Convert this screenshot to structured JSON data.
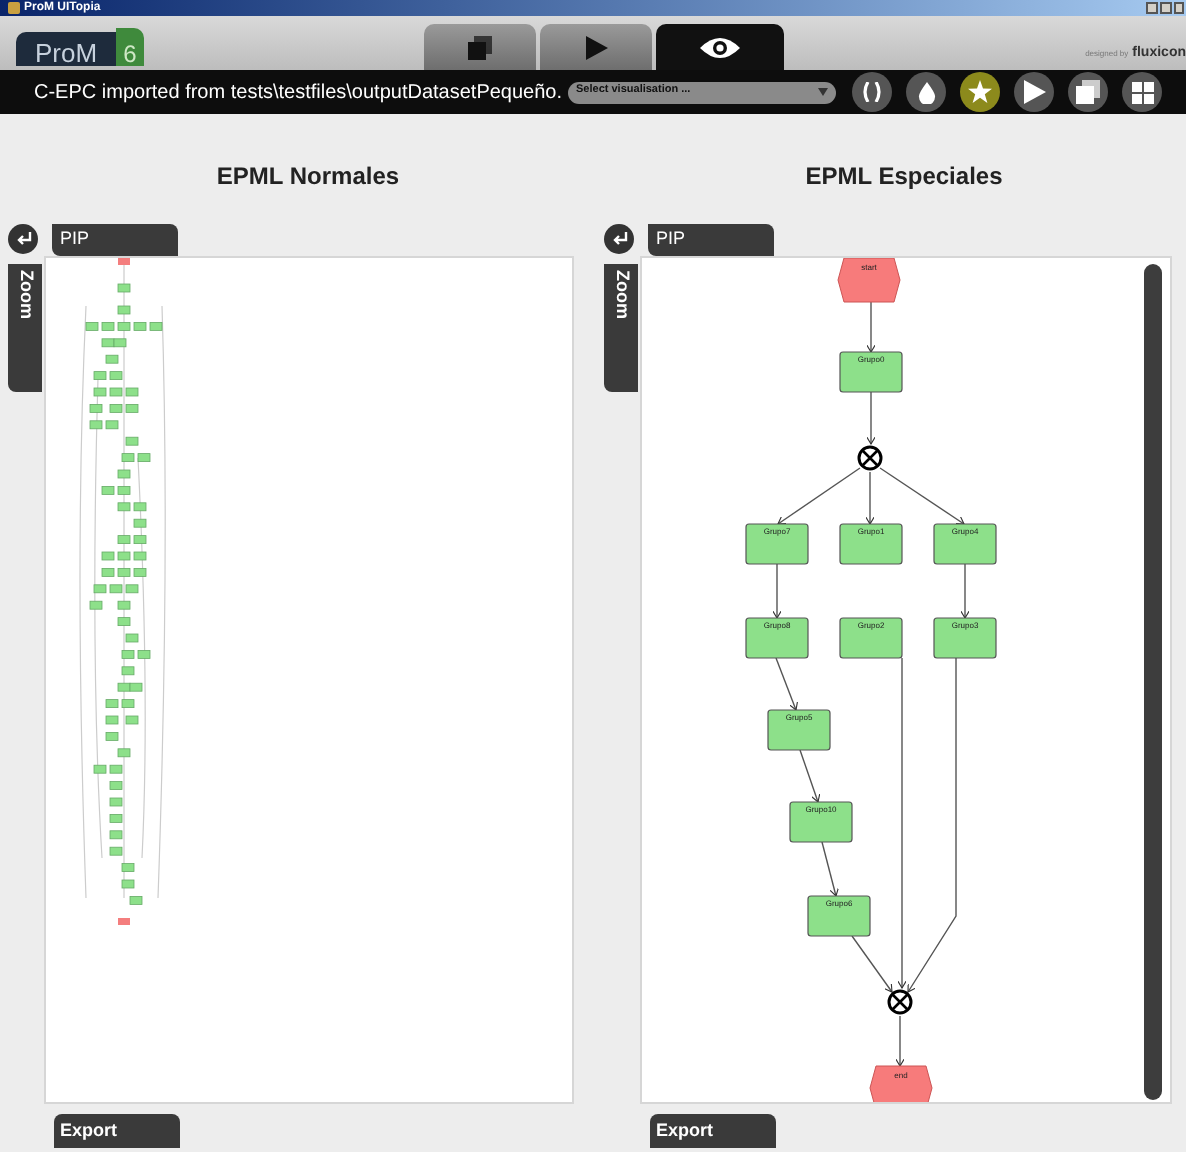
{
  "window": {
    "title": "ProM UITopia"
  },
  "logo": {
    "name": "ProM",
    "version": "6"
  },
  "credit": {
    "prefix": "designed by",
    "brand": "fluxicon"
  },
  "tabs": [
    {
      "selected": false
    },
    {
      "selected": false
    },
    {
      "selected": true
    }
  ],
  "toolbar": {
    "title": "C-EPC imported from tests\\testfiles\\outputDatasetPequeño.",
    "select": {
      "placeholder": "Select visualisation ..."
    },
    "actions": [
      {
        "selected": false
      },
      {
        "selected": false
      },
      {
        "selected": true
      },
      {
        "selected": false
      },
      {
        "selected": false
      },
      {
        "selected": false
      }
    ]
  },
  "panels": [
    {
      "heading": "EPML Normales",
      "pip": "PIP",
      "zoom": "Zoom",
      "export": "Export",
      "graph": {
        "kind": "miniature"
      }
    },
    {
      "heading": "EPML Especiales",
      "pip": "PIP",
      "zoom": "Zoom",
      "export": "Export",
      "graph": {
        "kind": "detailed",
        "nodes": [
          {
            "kind": "event",
            "label": "start"
          },
          {
            "kind": "function",
            "label": "Grupo0"
          },
          {
            "kind": "connector"
          },
          {
            "kind": "function",
            "label": "Grupo7"
          },
          {
            "kind": "function",
            "label": "Grupo1"
          },
          {
            "kind": "function",
            "label": "Grupo4"
          },
          {
            "kind": "function",
            "label": "Grupo8"
          },
          {
            "kind": "function",
            "label": "Grupo2"
          },
          {
            "kind": "function",
            "label": "Grupo3"
          },
          {
            "kind": "function",
            "label": "Grupo5"
          },
          {
            "kind": "function",
            "label": "Grupo10"
          },
          {
            "kind": "function",
            "label": "Grupo6"
          },
          {
            "kind": "connector"
          },
          {
            "kind": "event",
            "label": "end"
          }
        ]
      }
    }
  ]
}
